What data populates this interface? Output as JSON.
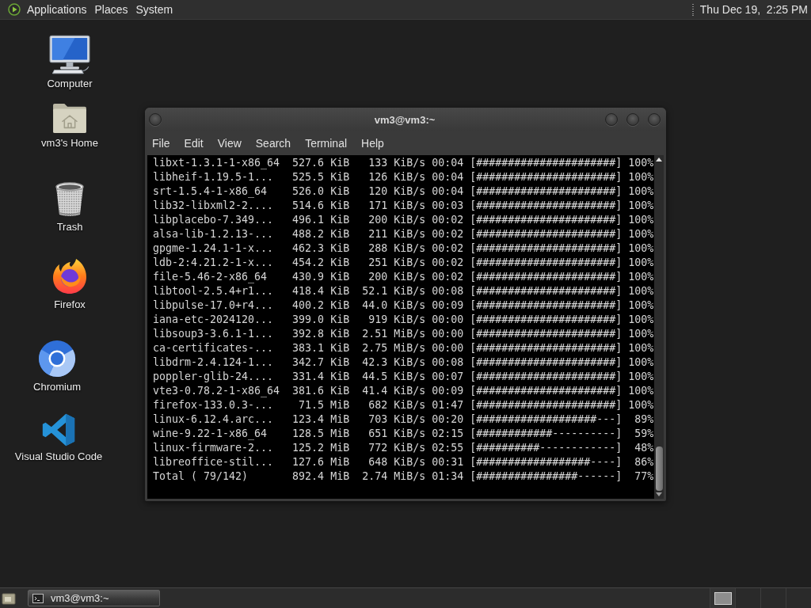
{
  "top_panel": {
    "menus": [
      "Applications",
      "Places",
      "System"
    ],
    "clock": "Thu Dec 19,  2:25 PM"
  },
  "desktop_icons": [
    {
      "label": "Computer",
      "kind": "computer"
    },
    {
      "label": "vm3's Home",
      "kind": "home"
    },
    {
      "label": "Trash",
      "kind": "trash"
    },
    {
      "label": "Firefox",
      "kind": "firefox"
    },
    {
      "label": "Chromium",
      "kind": "chromium"
    },
    {
      "label": "Visual Studio Code",
      "kind": "vscode"
    }
  ],
  "terminal_window": {
    "title": "vm3@vm3:~",
    "menu": [
      "File",
      "Edit",
      "View",
      "Search",
      "Terminal",
      "Help"
    ],
    "rows": [
      {
        "package": "libxt-1.3.1-1-x86_64",
        "size": "527.6 KiB",
        "rate": "133 KiB/s",
        "time": "00:04",
        "bar": "[######################]",
        "percent": "100%"
      },
      {
        "package": "libheif-1.19.5-1...",
        "size": "525.5 KiB",
        "rate": "126 KiB/s",
        "time": "00:04",
        "bar": "[######################]",
        "percent": "100%"
      },
      {
        "package": "srt-1.5.4-1-x86_64",
        "size": "526.0 KiB",
        "rate": "120 KiB/s",
        "time": "00:04",
        "bar": "[######################]",
        "percent": "100%"
      },
      {
        "package": "lib32-libxml2-2....",
        "size": "514.6 KiB",
        "rate": "171 KiB/s",
        "time": "00:03",
        "bar": "[######################]",
        "percent": "100%"
      },
      {
        "package": "libplacebo-7.349...",
        "size": "496.1 KiB",
        "rate": "200 KiB/s",
        "time": "00:02",
        "bar": "[######################]",
        "percent": "100%"
      },
      {
        "package": "alsa-lib-1.2.13-...",
        "size": "488.2 KiB",
        "rate": "211 KiB/s",
        "time": "00:02",
        "bar": "[######################]",
        "percent": "100%"
      },
      {
        "package": "gpgme-1.24.1-1-x...",
        "size": "462.3 KiB",
        "rate": "288 KiB/s",
        "time": "00:02",
        "bar": "[######################]",
        "percent": "100%"
      },
      {
        "package": "ldb-2:4.21.2-1-x...",
        "size": "454.2 KiB",
        "rate": "251 KiB/s",
        "time": "00:02",
        "bar": "[######################]",
        "percent": "100%"
      },
      {
        "package": "file-5.46-2-x86_64",
        "size": "430.9 KiB",
        "rate": "200 KiB/s",
        "time": "00:02",
        "bar": "[######################]",
        "percent": "100%"
      },
      {
        "package": "libtool-2.5.4+r1...",
        "size": "418.4 KiB",
        "rate": "52.1 KiB/s",
        "time": "00:08",
        "bar": "[######################]",
        "percent": "100%"
      },
      {
        "package": "libpulse-17.0+r4...",
        "size": "400.2 KiB",
        "rate": "44.0 KiB/s",
        "time": "00:09",
        "bar": "[######################]",
        "percent": "100%"
      },
      {
        "package": "iana-etc-2024120...",
        "size": "399.0 KiB",
        "rate": "919 KiB/s",
        "time": "00:00",
        "bar": "[######################]",
        "percent": "100%"
      },
      {
        "package": "libsoup3-3.6.1-1...",
        "size": "392.8 KiB",
        "rate": "2.51 MiB/s",
        "time": "00:00",
        "bar": "[######################]",
        "percent": "100%"
      },
      {
        "package": "ca-certificates-...",
        "size": "383.1 KiB",
        "rate": "2.75 MiB/s",
        "time": "00:00",
        "bar": "[######################]",
        "percent": "100%"
      },
      {
        "package": "libdrm-2.4.124-1...",
        "size": "342.7 KiB",
        "rate": "42.3 KiB/s",
        "time": "00:08",
        "bar": "[######################]",
        "percent": "100%"
      },
      {
        "package": "poppler-glib-24....",
        "size": "331.4 KiB",
        "rate": "44.5 KiB/s",
        "time": "00:07",
        "bar": "[######################]",
        "percent": "100%"
      },
      {
        "package": "vte3-0.78.2-1-x86_64",
        "size": "381.6 KiB",
        "rate": "41.4 KiB/s",
        "time": "00:09",
        "bar": "[######################]",
        "percent": "100%"
      },
      {
        "package": "firefox-133.0.3-...",
        "size": "71.5 MiB",
        "rate": "682 KiB/s",
        "time": "01:47",
        "bar": "[######################]",
        "percent": "100%"
      },
      {
        "package": "linux-6.12.4.arc...",
        "size": "123.4 MiB",
        "rate": "703 KiB/s",
        "time": "00:20",
        "bar": "[###################---]",
        "percent": "89%"
      },
      {
        "package": "wine-9.22-1-x86_64",
        "size": "128.5 MiB",
        "rate": "651 KiB/s",
        "time": "02:15",
        "bar": "[############----------]",
        "percent": "59%"
      },
      {
        "package": "linux-firmware-2...",
        "size": "125.2 MiB",
        "rate": "772 KiB/s",
        "time": "02:55",
        "bar": "[##########------------]",
        "percent": "48%"
      },
      {
        "package": "libreoffice-stil...",
        "size": "127.6 MiB",
        "rate": "648 KiB/s",
        "time": "00:31",
        "bar": "[##################----]",
        "percent": "86%"
      },
      {
        "package": "Total ( 79/142)",
        "size": "892.4 MiB",
        "rate": "2.74 MiB/s",
        "time": "01:34",
        "bar": "[################------]",
        "percent": "77%"
      }
    ]
  },
  "taskbar": {
    "tasks": [
      {
        "label": "vm3@vm3:~",
        "selected": true
      }
    ]
  }
}
